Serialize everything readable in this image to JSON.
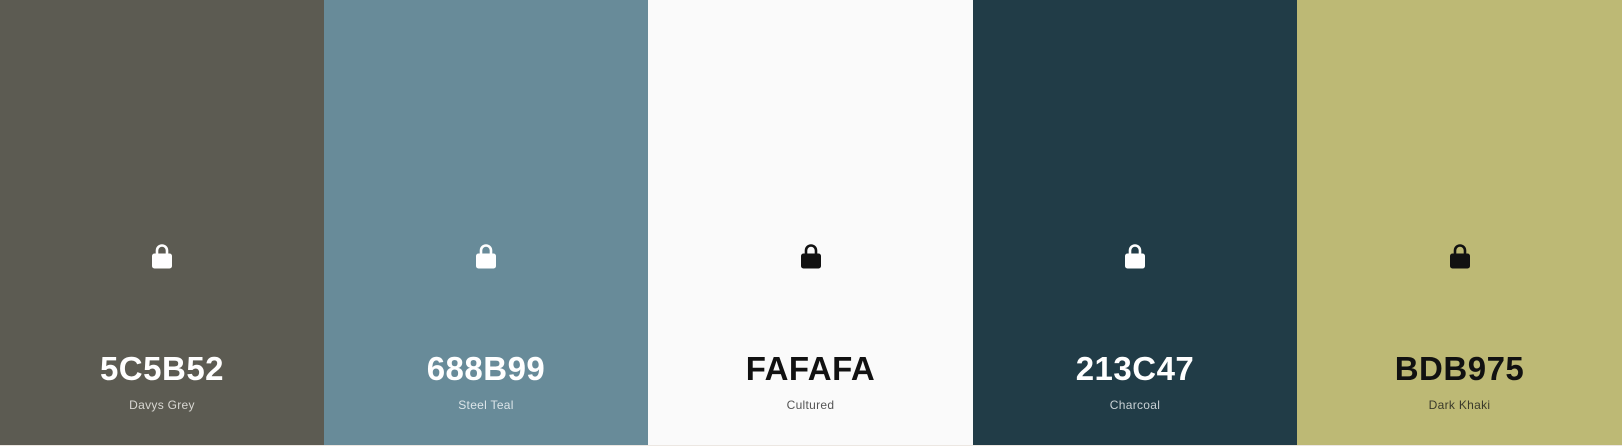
{
  "palette": {
    "swatches": [
      {
        "hex": "5C5B52",
        "name": "Davys Grey",
        "bg": "#5C5B52",
        "fg": "#ffffff",
        "name_color": "#d8d7d2",
        "icon": "lock-icon"
      },
      {
        "hex": "688B99",
        "name": "Steel Teal",
        "bg": "#688B99",
        "fg": "#ffffff",
        "name_color": "#dce5e9",
        "icon": "lock-icon"
      },
      {
        "hex": "FAFAFA",
        "name": "Cultured",
        "bg": "#FAFAFA",
        "fg": "#111111",
        "name_color": "#555555",
        "icon": "lock-icon"
      },
      {
        "hex": "213C47",
        "name": "Charcoal",
        "bg": "#213C47",
        "fg": "#ffffff",
        "name_color": "#c9d1d5",
        "icon": "lock-icon"
      },
      {
        "hex": "BDB975",
        "name": "Dark Khaki",
        "bg": "#BDB975",
        "fg": "#111111",
        "name_color": "#3a3a2a",
        "icon": "lock-icon"
      }
    ]
  }
}
